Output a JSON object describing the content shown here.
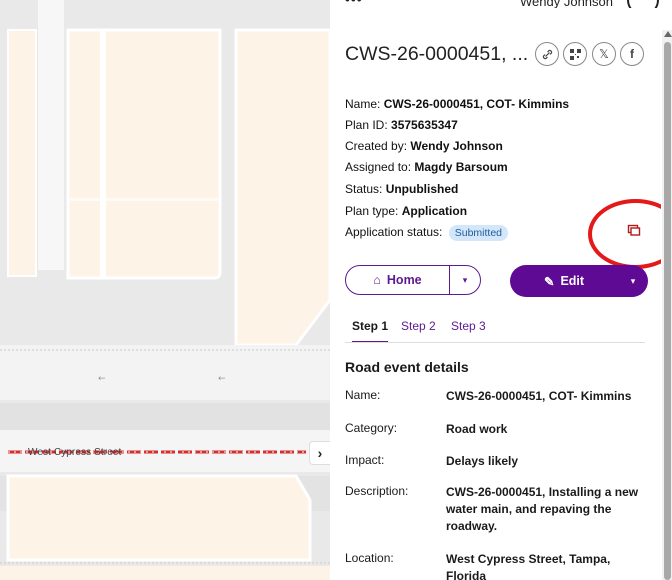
{
  "header": {
    "menu_glyph": "•••",
    "user_name": "Wendy Johnson"
  },
  "map": {
    "street_label": "West Cypress Street",
    "collapse_glyph": "›",
    "colors": {
      "parcel": "#fdf3e7",
      "road": "#e6e6e6",
      "closure_red": "#d32f2f"
    }
  },
  "plan": {
    "title": "CWS-26-0000451, ...",
    "share": {
      "link_icon": "link-icon",
      "qr_icon": "qr-code-icon",
      "x_glyph": "𝕏",
      "fb_glyph": "f"
    },
    "meta": [
      {
        "label": "Name: ",
        "value": "CWS-26-0000451, COT- Kimmins"
      },
      {
        "label": "Plan ID: ",
        "value": "3575635347"
      },
      {
        "label": "Created by: ",
        "value": "Wendy Johnson"
      },
      {
        "label": "Assigned to: ",
        "value": "Magdy Barsoum"
      },
      {
        "label": "Status: ",
        "value": "Unpublished"
      },
      {
        "label": "Plan type: ",
        "value": "Application"
      }
    ],
    "application_status_label": "Application status: ",
    "application_status_badge": "Submitted",
    "badge_color": "#d3e6fa"
  },
  "actions": {
    "home_label": "Home",
    "edit_label": "Edit",
    "dropdown_glyph": "▾",
    "home_glyph": "⌂",
    "edit_glyph": "✎",
    "accent_color": "#5e0a94"
  },
  "tabs": [
    {
      "label": "Step 1",
      "active": true
    },
    {
      "label": "Step 2",
      "active": false
    },
    {
      "label": "Step 3",
      "active": false
    }
  ],
  "details": {
    "title": "Road event details",
    "rows": [
      {
        "label": "Name:",
        "value": "CWS-26-0000451, COT- Kimmins"
      },
      {
        "label": "Category:",
        "value": "Road work"
      },
      {
        "label": "Impact:",
        "value": "Delays likely"
      },
      {
        "label": "Description:",
        "value": "CWS-26-0000451, Installing a new water main, and repaving the roadway."
      },
      {
        "label": "Location:",
        "value": "West Cypress Street, Tampa, Florida"
      }
    ]
  }
}
